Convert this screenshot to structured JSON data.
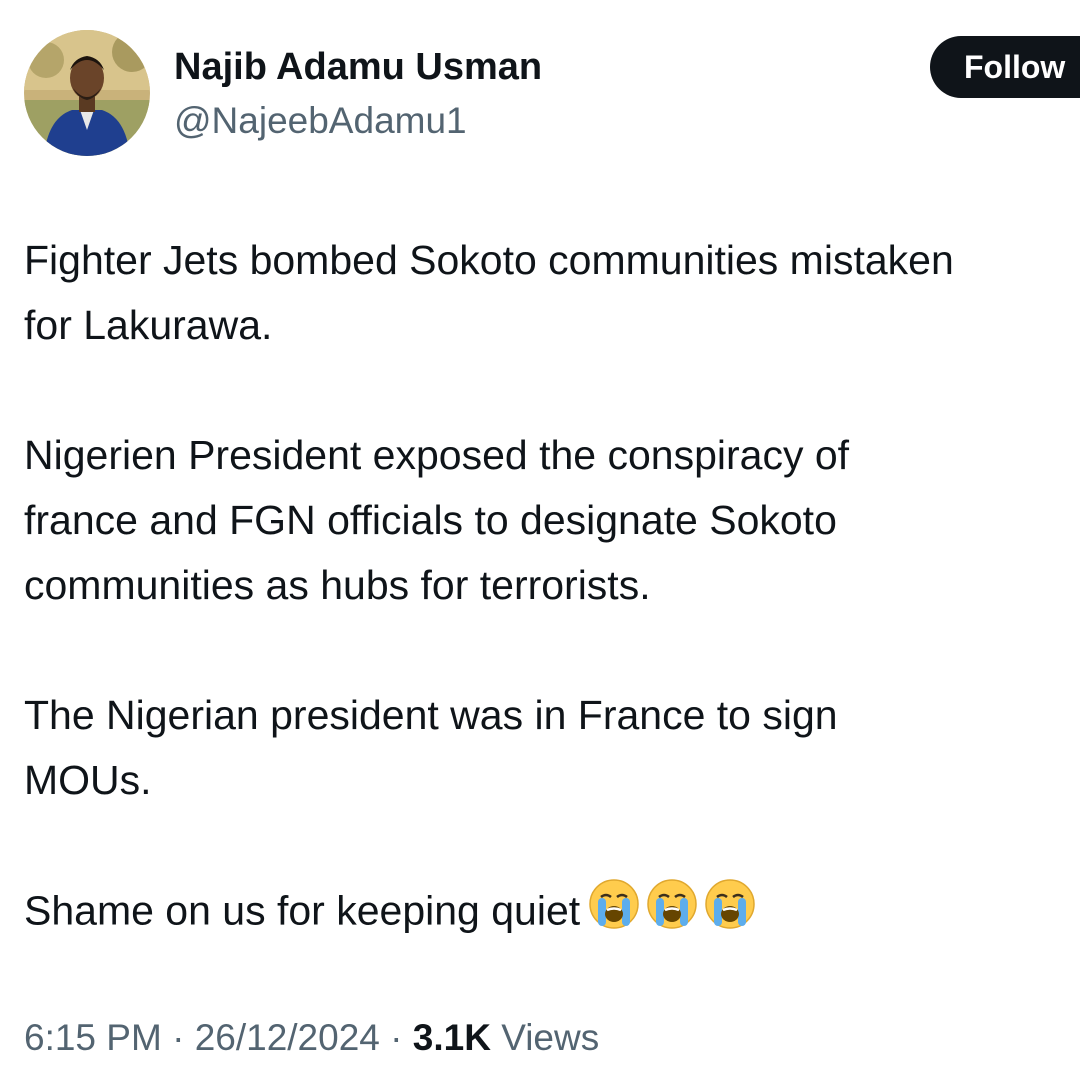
{
  "author": {
    "display_name": "Najib Adamu Usman",
    "handle": "@NajeebAdamu1"
  },
  "follow_button": {
    "label": "Follow"
  },
  "tweet": {
    "paragraphs": [
      {
        "lines": [
          "Fighter Jets bombed Sokoto communities mistaken",
          "for Lakurawa."
        ]
      },
      {
        "lines": [
          "Nigerien President exposed the conspiracy of",
          "france and FGN officials to designate Sokoto",
          "communities as hubs for terrorists."
        ]
      },
      {
        "lines": [
          "The Nigerian president was in France to sign",
          "MOUs."
        ]
      },
      {
        "lines": [
          "Shame on us for keeping quiet"
        ],
        "emojis": [
          "loudly-crying-face-icon",
          "loudly-crying-face-icon",
          "loudly-crying-face-icon"
        ]
      }
    ]
  },
  "meta": {
    "time": "6:15 PM",
    "separator": "·",
    "date": "26/12/2024",
    "views_count": "3.1K",
    "views_label": "Views"
  },
  "colors": {
    "text": "#0f1419",
    "secondary": "#536471",
    "follow_bg": "#0f1419"
  }
}
